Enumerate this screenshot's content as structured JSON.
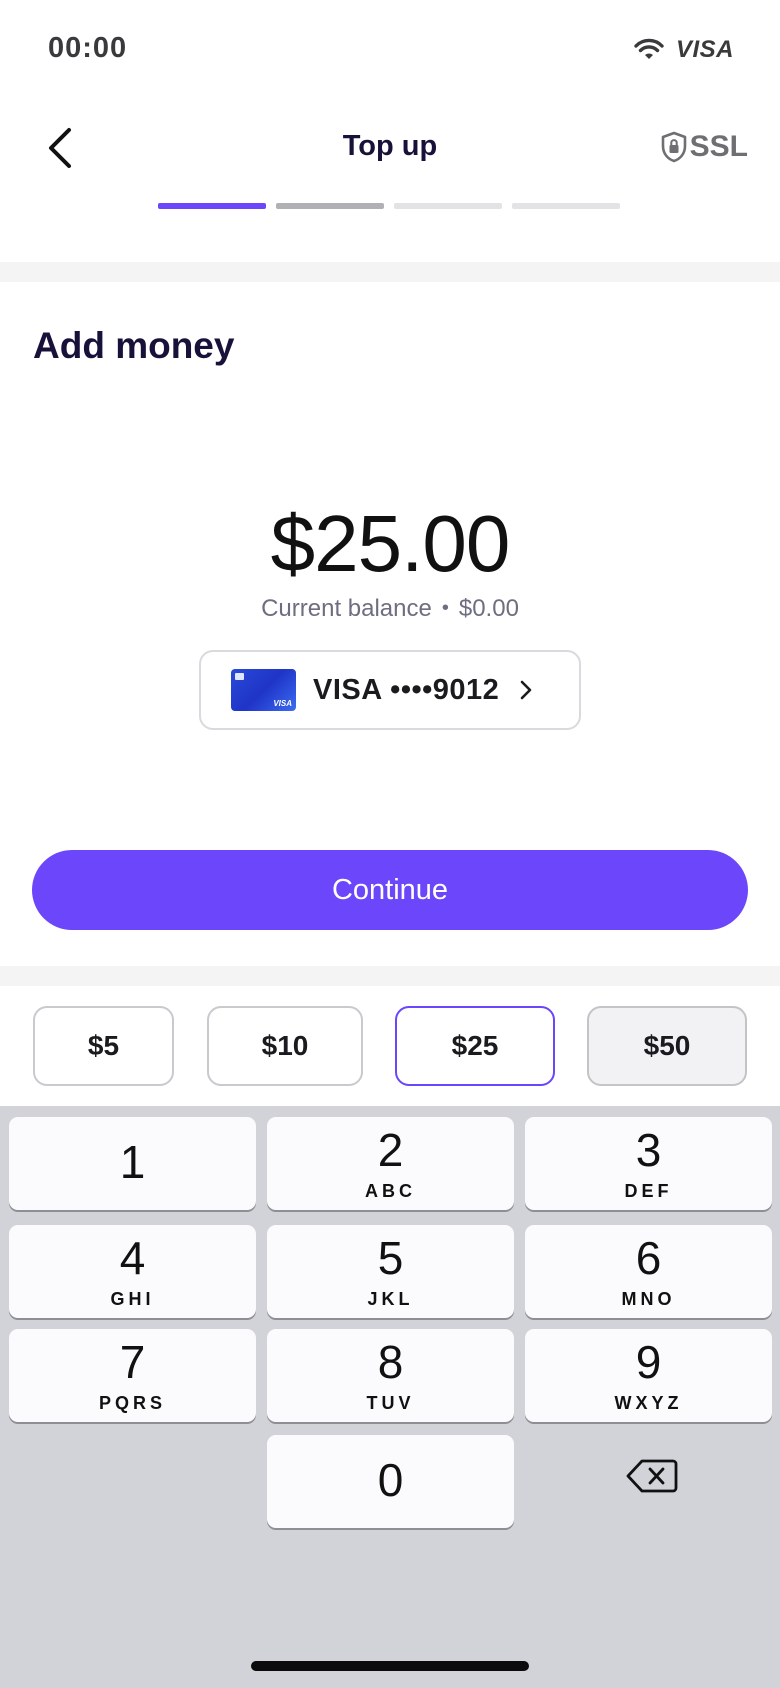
{
  "status_bar": {
    "time": "00:00",
    "brand": "VISA"
  },
  "header": {
    "title": "Top up",
    "ssl_label": "SSL",
    "progress_steps": 4,
    "current_step": 1
  },
  "main": {
    "section_title": "Add money",
    "amount": "$25.00",
    "balance_label": "Current balance",
    "balance_separator": "•",
    "balance_value": "$0.00",
    "card": {
      "brand": "VISA",
      "masked_number": "••••9012",
      "label": "VISA ••••9012",
      "thumb_brand": "VISA"
    },
    "continue_label": "Continue"
  },
  "quick_amounts": [
    {
      "label": "$5",
      "state": "default"
    },
    {
      "label": "$10",
      "state": "default"
    },
    {
      "label": "$25",
      "state": "selected"
    },
    {
      "label": "$50",
      "state": "pressed"
    }
  ],
  "keypad": {
    "keys": [
      {
        "digit": "1",
        "letters": ""
      },
      {
        "digit": "2",
        "letters": "ABC"
      },
      {
        "digit": "3",
        "letters": "DEF"
      },
      {
        "digit": "4",
        "letters": "GHI"
      },
      {
        "digit": "5",
        "letters": "JKL"
      },
      {
        "digit": "6",
        "letters": "MNO"
      },
      {
        "digit": "7",
        "letters": "PQRS"
      },
      {
        "digit": "8",
        "letters": "TUV"
      },
      {
        "digit": "9",
        "letters": "WXYZ"
      },
      {
        "digit": "0",
        "letters": ""
      }
    ],
    "delete_icon": "backspace-icon"
  },
  "colors": {
    "accent": "#6b46fa",
    "title": "#17123a",
    "keypad_bg": "#d1d3d8"
  }
}
